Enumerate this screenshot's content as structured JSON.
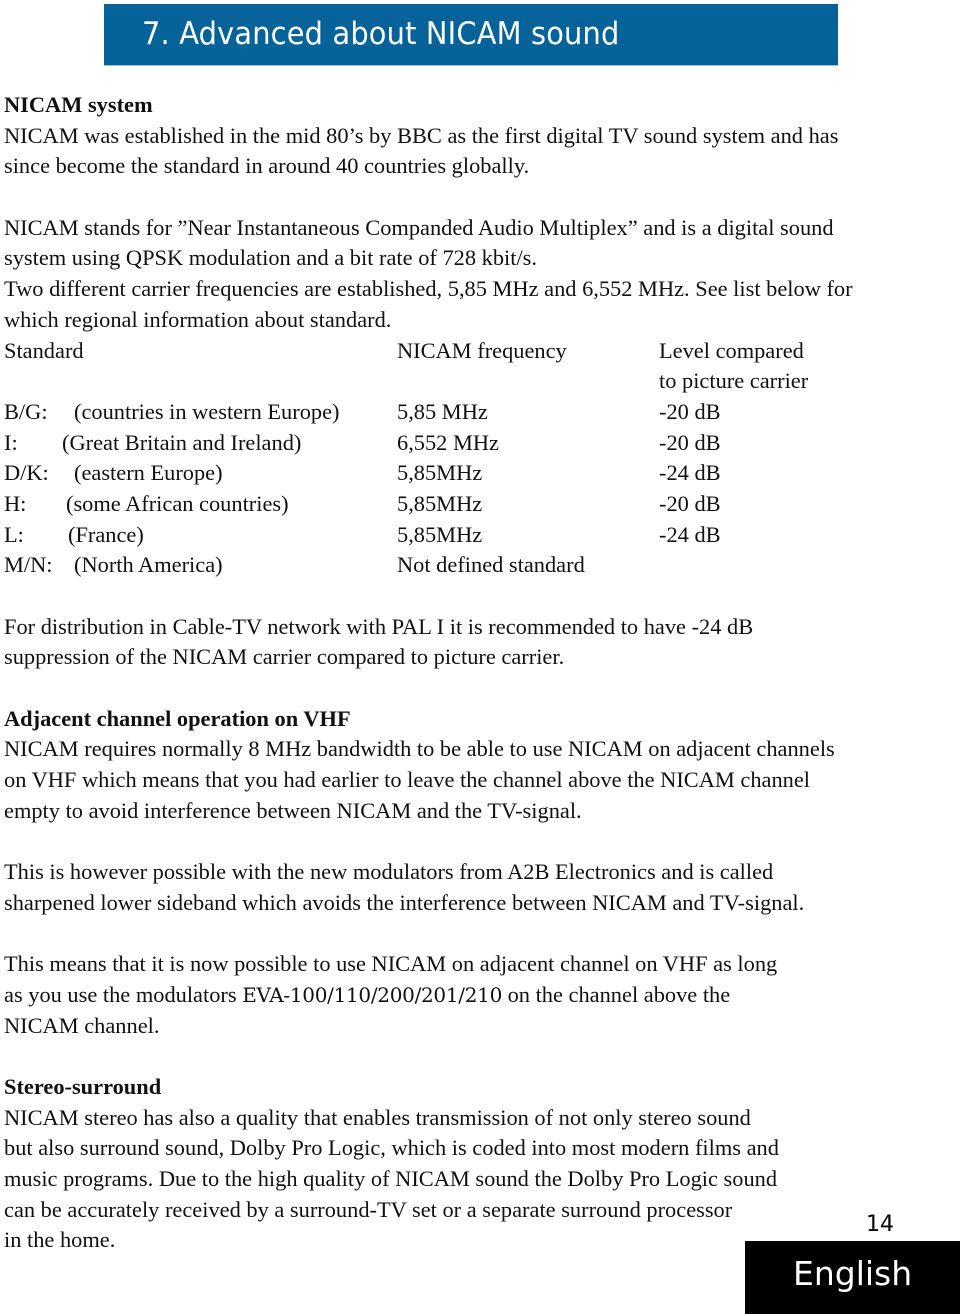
{
  "header": {
    "title": "7. Advanced about NICAM sound",
    "banner_color": "#06639a"
  },
  "sections": {
    "nicam_system": {
      "heading": "NICAM system",
      "lines": [
        "NICAM was established in the mid 80’s by BBC as the first digital TV sound system and has",
        "since become the standard in around 40 countries globally."
      ],
      "para2_lines": [
        "NICAM stands for ”Near Instantaneous Companded Audio Multiplex” and is a digital sound",
        "system using QPSK modulation and a bit rate of 728 kbit/s.",
        "Two different carrier frequencies are established, 5,85 MHz and 6,552 MHz. See list below for",
        "which regional information about standard."
      ]
    },
    "standards_table": {
      "headers": {
        "standard": "Standard",
        "frequency": "NICAM frequency",
        "level_line1": "Level compared",
        "level_line2": "to picture carrier"
      },
      "rows": [
        {
          "code": "B/G:",
          "region": "(countries in western Europe)",
          "frequency": "5,85 MHz",
          "level": "-20 dB"
        },
        {
          "code": "I:",
          "region": "(Great Britain and Ireland)",
          "frequency": "6,552 MHz",
          "level": "-20 dB"
        },
        {
          "code": "D/K:",
          "region": "(eastern Europe)",
          "frequency": "5,85MHz",
          "level": "-24 dB"
        },
        {
          "code": "H:",
          "region": "(some African countries)",
          "frequency": "5,85MHz",
          "level": "-20 dB"
        },
        {
          "code": "L:",
          "region": "(France)",
          "frequency": "5,85MHz",
          "level": "-24 dB"
        },
        {
          "code": "M/N:",
          "region": "(North America)",
          "frequency": "Not defined standard",
          "level": ""
        }
      ]
    },
    "cable_note": {
      "lines": [
        "For distribution in Cable-TV network with PAL I it is recommended to have -24 dB",
        "suppression of the NICAM carrier compared to picture carrier."
      ]
    },
    "adjacent_channel": {
      "heading": "Adjacent channel operation on VHF",
      "para1_lines": [
        "NICAM requires normally 8 MHz bandwidth to be able to use NICAM on adjacent channels",
        "on VHF which means that you had earlier to leave the channel above the NICAM channel",
        "empty to avoid interference between NICAM and the TV-signal."
      ],
      "para2_lines": [
        "This is however possible with the new modulators from A2B Electronics and is called",
        "sharpened lower sideband which avoids the interference between NICAM and TV-signal."
      ],
      "para3": {
        "line1": "This means that it is now possible to use NICAM on adjacent channel on VHF as long",
        "line2_before": "as you use the modulators ",
        "line2_models": "EVA-100/110/200/201/210",
        "line2_after": " on the channel above the",
        "line3": "NICAM channel."
      }
    },
    "stereo_surround": {
      "heading": "Stereo-surround",
      "lines": [
        "NICAM stereo has also a quality that enables transmission of not only stereo sound",
        "but also surround sound, Dolby Pro Logic, which is coded into most modern films and",
        "music programs. Due to the high quality of NICAM sound the Dolby Pro Logic sound",
        "can be accurately received by a surround-TV set or a separate surround processor",
        "in the home."
      ]
    }
  },
  "footer": {
    "page_number": "14",
    "language": "English"
  }
}
